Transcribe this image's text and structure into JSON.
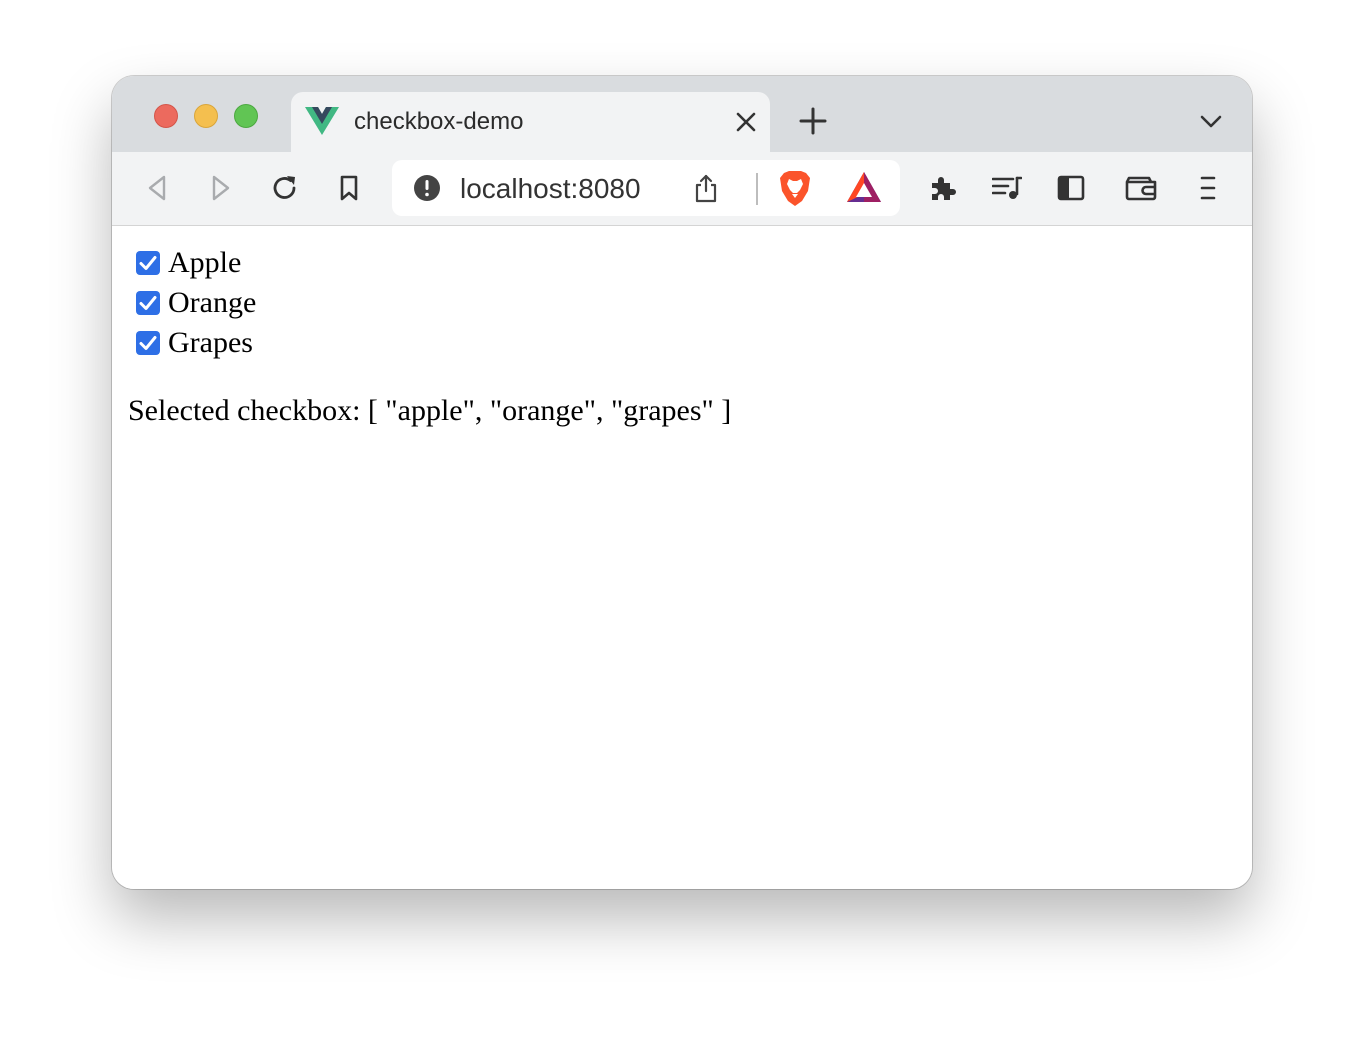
{
  "tab": {
    "title": "checkbox-demo",
    "favicon": "vue-logo-icon"
  },
  "toolbar": {
    "url": "localhost:8080"
  },
  "icons": {
    "back": "back-arrow-icon",
    "forward": "forward-arrow-icon",
    "reload": "reload-icon",
    "bookmark": "bookmark-icon",
    "site_info": "info-warning-icon",
    "share": "share-icon",
    "brave_shields": "brave-lion-icon",
    "brave_rewards": "bat-triangle-icon",
    "extensions": "puzzle-icon",
    "media": "playlist-icon",
    "sidebar": "sidebar-icon",
    "wallet": "wallet-icon",
    "menu": "hamburger-menu-icon"
  },
  "checkboxes": [
    {
      "label": "Apple",
      "checked": true
    },
    {
      "label": "Orange",
      "checked": true
    },
    {
      "label": "Grapes",
      "checked": true
    }
  ],
  "selected_text": "Selected checkbox: [ \"apple\", \"orange\", \"grapes\" ]",
  "colors": {
    "checkbox_accent": "#2e6fe6",
    "brave_orange": "#fb542b"
  }
}
